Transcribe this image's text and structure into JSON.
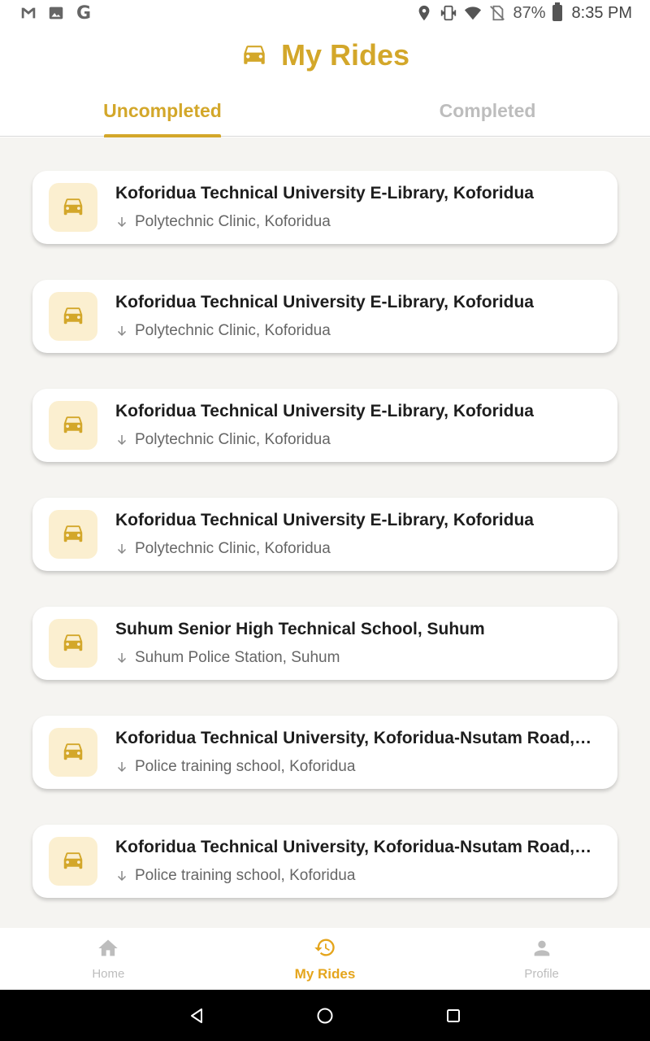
{
  "status_bar": {
    "battery": "87%",
    "time": "8:35 PM",
    "left_icons": [
      "gmail-icon",
      "image-icon",
      "google-icon"
    ],
    "right_icons": [
      "location-icon",
      "vibrate-icon",
      "wifi-icon",
      "no-sim-icon",
      "battery-icon"
    ]
  },
  "header": {
    "title": "My Rides"
  },
  "tabs": [
    {
      "label": "Uncompleted",
      "active": true
    },
    {
      "label": "Completed",
      "active": false
    }
  ],
  "rides": [
    {
      "from": "Koforidua Technical University E-Library, Koforidua",
      "to": "Polytechnic Clinic, Koforidua"
    },
    {
      "from": "Koforidua Technical University E-Library, Koforidua",
      "to": "Polytechnic Clinic, Koforidua"
    },
    {
      "from": "Koforidua Technical University E-Library, Koforidua",
      "to": "Polytechnic Clinic, Koforidua"
    },
    {
      "from": "Koforidua Technical University E-Library, Koforidua",
      "to": "Polytechnic Clinic, Koforidua"
    },
    {
      "from": "Suhum Senior High Technical School, Suhum",
      "to": "Suhum Police Station, Suhum"
    },
    {
      "from": "Koforidua Technical University, Koforidua-Nsutam Road, Koforidua",
      "to": "Police training school, Koforidua"
    },
    {
      "from": "Koforidua Technical University, Koforidua-Nsutam Road, Koforidua",
      "to": "Police training school, Koforidua"
    }
  ],
  "bottom_nav": [
    {
      "label": "Home",
      "icon": "home-icon",
      "active": false
    },
    {
      "label": "My Rides",
      "icon": "history-icon",
      "active": true
    },
    {
      "label": "Profile",
      "icon": "person-icon",
      "active": false
    }
  ],
  "colors": {
    "accent": "#d3a72a",
    "nav_active": "#e5a51c",
    "icon_bg": "#fbefd0",
    "content_bg": "#f5f4f1"
  }
}
